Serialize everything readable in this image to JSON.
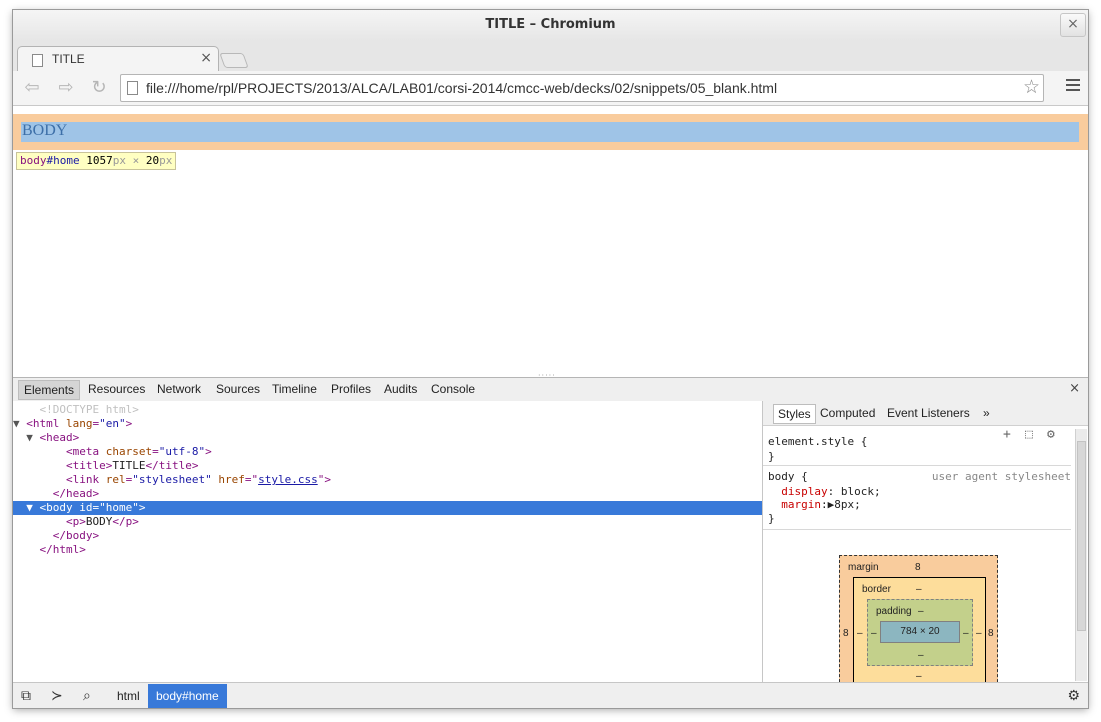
{
  "window": {
    "title": "TITLE – Chromium",
    "close_glyph": "×"
  },
  "tab": {
    "title": "TITLE",
    "close_glyph": "×"
  },
  "toolbar": {
    "url": "file:///home/rpl/PROJECTS/2013/ALCA/LAB01/corsi-2014/cmcc-web/decks/02/snippets/05_blank.html"
  },
  "page": {
    "body_text": "BODY"
  },
  "tooltip": {
    "tag": "body",
    "id": "#home",
    "width": "1057",
    "unit1": "px",
    "times": " × ",
    "height": "20",
    "unit2": "px"
  },
  "devtools": {
    "tabs": [
      "Elements",
      "Resources",
      "Network",
      "Sources",
      "Timeline",
      "Profiles",
      "Audits",
      "Console"
    ],
    "close_glyph": "×",
    "dom": {
      "doctype": "<!DOCTYPE html>",
      "html_open_tag": "<html",
      "html_lang_attr": "lang",
      "html_lang_val": "\"en\"",
      "head_open": "<head>",
      "meta_tag": "<meta",
      "meta_attr": "charset",
      "meta_val": "\"utf-8\"",
      "meta_close": ">",
      "title_open": "<title>",
      "title_text": "TITLE",
      "title_close": "</title>",
      "link_tag": "<link",
      "link_rel_attr": "rel",
      "link_rel_val": "\"stylesheet\"",
      "link_href_attr": "href",
      "link_href_val": "style.css",
      "head_close": "</head>",
      "body_open_tag": "<body",
      "body_id_attr": "id",
      "body_id_val": "\"home\"",
      "p_open": "<p>",
      "p_text": "BODY",
      "p_close": "</p>",
      "body_close": "</body>",
      "html_close": "</html>"
    },
    "styles_tabs": [
      "Styles",
      "Computed",
      "Event Listeners",
      "»"
    ],
    "element_style": "element.style {",
    "close_brace": "}",
    "body_selector": "body {",
    "ua_label": "user agent stylesheet",
    "rules": [
      {
        "prop": "display",
        "value": "block;"
      },
      {
        "prop": "margin",
        "value": "8px;"
      }
    ],
    "box_model": {
      "margin_label": "margin",
      "margin_value": "8",
      "margin_left": "8",
      "margin_right": "8",
      "border_label": "border",
      "border_value": "–",
      "border_left": "–",
      "border_right": "–",
      "border_bottom": "–",
      "padding_label": "padding",
      "padding_value": "–",
      "padding_left": "–",
      "padding_right": "–",
      "padding_bottom": "–",
      "content": "784 × 20"
    }
  },
  "statusbar": {
    "crumbs": [
      "html",
      "body#home"
    ]
  }
}
